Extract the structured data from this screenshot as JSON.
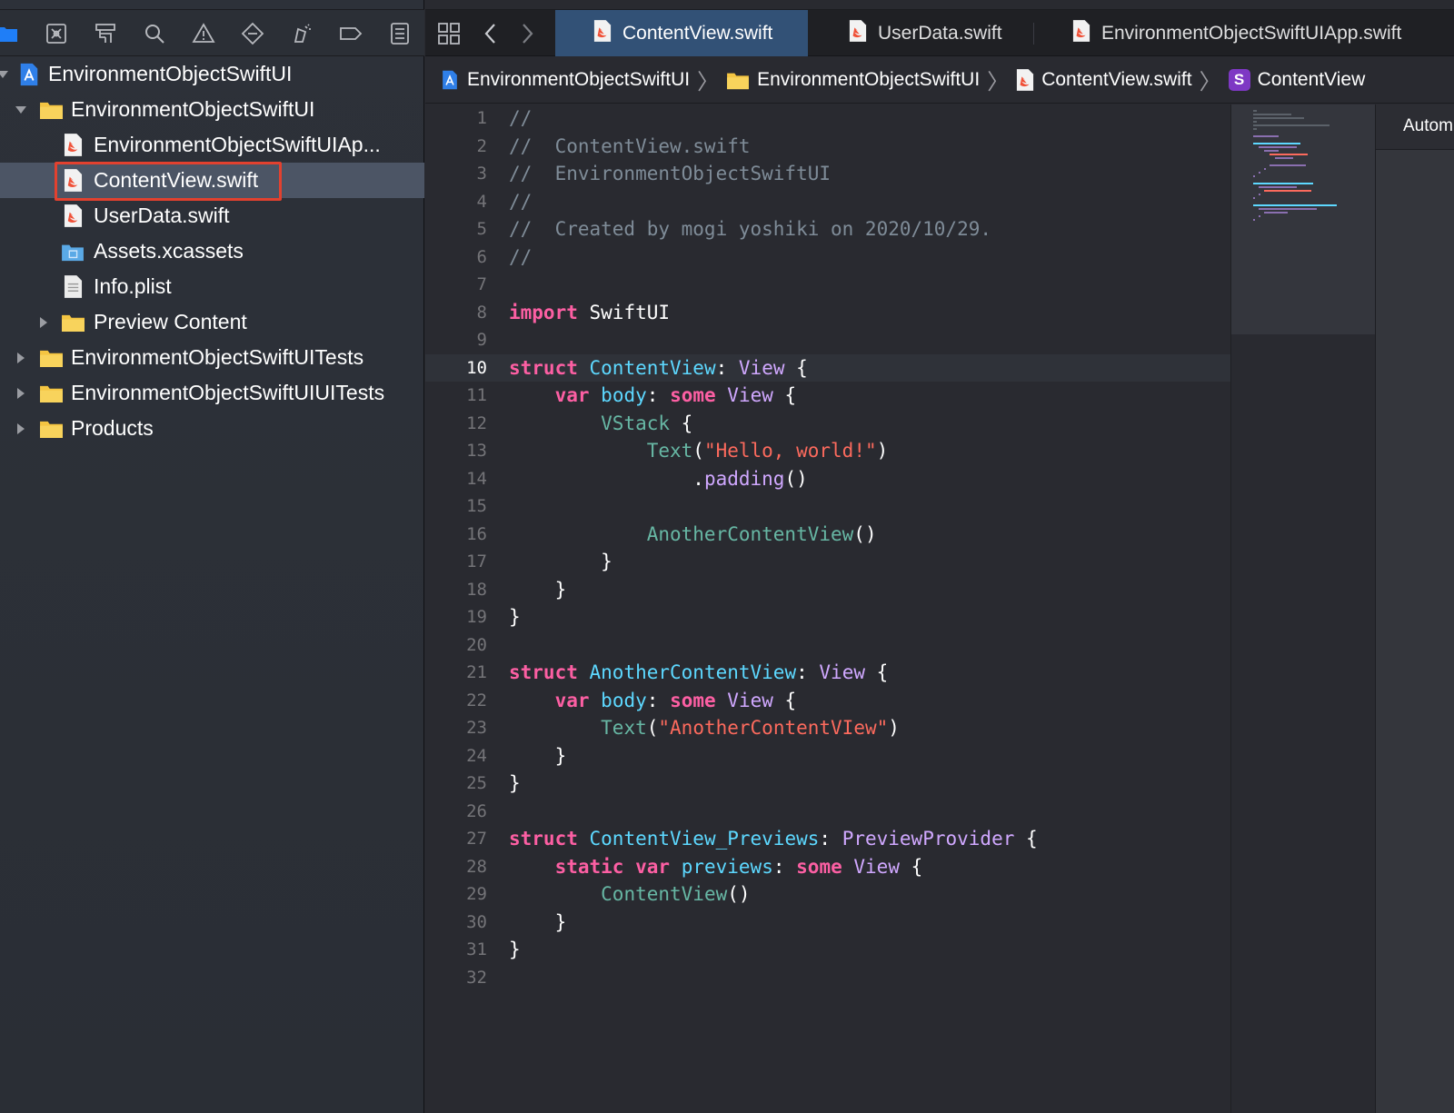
{
  "navigator": {
    "toolbar_icons": [
      "folder-icon",
      "source-control-icon",
      "symbol-icon",
      "find-icon",
      "issue-icon",
      "test-icon",
      "debug-icon",
      "breakpoint-icon",
      "report-icon"
    ],
    "tree": [
      {
        "label": "EnvironmentObjectSwiftUI",
        "icon": "project-icon",
        "level": 0,
        "expanded": true
      },
      {
        "label": "EnvironmentObjectSwiftUI",
        "icon": "folder-icon",
        "level": 1,
        "expanded": true
      },
      {
        "label": "EnvironmentObjectSwiftUIAp...",
        "icon": "swift-file-icon",
        "level": 2
      },
      {
        "label": "ContentView.swift",
        "icon": "swift-file-icon",
        "level": 2,
        "selected": true
      },
      {
        "label": "UserData.swift",
        "icon": "swift-file-icon",
        "level": 2
      },
      {
        "label": "Assets.xcassets",
        "icon": "asset-catalog-icon",
        "level": 2
      },
      {
        "label": "Info.plist",
        "icon": "plist-file-icon",
        "level": 2
      },
      {
        "label": "Preview Content",
        "icon": "folder-icon",
        "level": 2,
        "expanded": false
      },
      {
        "label": "EnvironmentObjectSwiftUITests",
        "icon": "folder-icon",
        "level": 1,
        "expanded": false
      },
      {
        "label": "EnvironmentObjectSwiftUIUITests",
        "icon": "folder-icon",
        "level": 1,
        "expanded": false
      },
      {
        "label": "Products",
        "icon": "folder-icon",
        "level": 1,
        "expanded": false
      }
    ]
  },
  "tabs": [
    {
      "label": "ContentView.swift",
      "active": true
    },
    {
      "label": "UserData.swift",
      "active": false
    },
    {
      "label": "EnvironmentObjectSwiftUIApp.swift",
      "active": false
    }
  ],
  "jumpbar": [
    {
      "label": "EnvironmentObjectSwiftUI",
      "icon": "project-icon"
    },
    {
      "label": "EnvironmentObjectSwiftUI",
      "icon": "folder-icon"
    },
    {
      "label": "ContentView.swift",
      "icon": "swift-file-icon"
    },
    {
      "label": "ContentView",
      "icon": "struct-symbol-icon",
      "badge": "S"
    }
  ],
  "editor": {
    "current_line": 10,
    "lines": [
      "//",
      "//  ContentView.swift",
      "//  EnvironmentObjectSwiftUI",
      "//",
      "//  Created by mogi yoshiki on 2020/10/29.",
      "//",
      "",
      "import SwiftUI",
      "",
      "struct ContentView: View {",
      "    var body: some View {",
      "        VStack {",
      "            Text(\"Hello, world!\")",
      "                .padding()",
      "",
      "            AnotherContentView()",
      "        }",
      "    }",
      "}",
      "",
      "struct AnotherContentView: View {",
      "    var body: some View {",
      "        Text(\"AnotherContentVIew\")",
      "    }",
      "}",
      "",
      "struct ContentView_Previews: PreviewProvider {",
      "    static var previews: some View {",
      "        ContentView()",
      "    }",
      "}",
      ""
    ]
  },
  "canvas": {
    "label": "Autom"
  },
  "colors": {
    "keyword": "#fc5fa3",
    "declaration": "#5dd8ff",
    "type": "#d0a8ff",
    "string": "#fc6a5d",
    "comment": "#7f8c98",
    "function": "#67b7a4",
    "selection_box": "#e2412f",
    "active_tab": "#325176"
  }
}
